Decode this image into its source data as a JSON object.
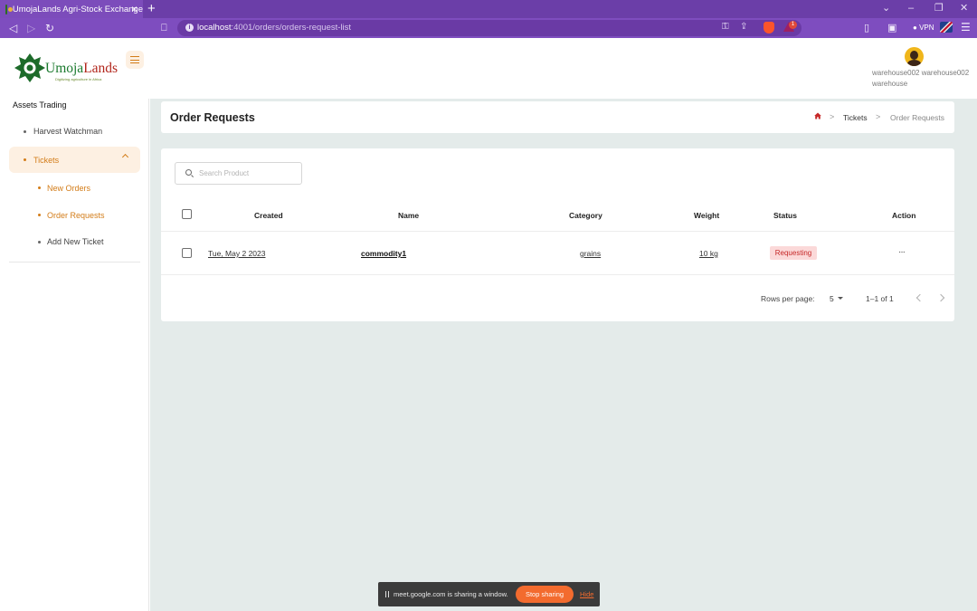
{
  "browser": {
    "tab_title": "UmojaLands Agri-Stock Exchange",
    "new_tab": "+",
    "url_host": "localhost",
    "url_rest": ":4001/orders/orders-request-list",
    "vpn": "VPN",
    "shields_badge": "1"
  },
  "header": {
    "logo_umoja": "Umoja",
    "logo_lands": "Lands",
    "logo_tagline": "Digitizing agriculture in Africa",
    "user_name": "warehouse002 warehouse002",
    "user_role": "warehouse"
  },
  "sidebar": {
    "heading": "Assets Trading",
    "items": [
      {
        "label": "Harvest Watchman"
      },
      {
        "label": "Tickets"
      }
    ],
    "subitems": [
      {
        "label": "New Orders"
      },
      {
        "label": "Order Requests"
      },
      {
        "label": "Add New Ticket"
      }
    ]
  },
  "page": {
    "title": "Order Requests",
    "breadcrumb": {
      "sep": ">",
      "tickets": "Tickets",
      "current": "Order Requests"
    }
  },
  "search": {
    "placeholder": "Search Product"
  },
  "table": {
    "columns": [
      "Created",
      "Name",
      "Category",
      "Weight",
      "Status",
      "Action"
    ],
    "rows": [
      {
        "created": "Tue, May 2 2023",
        "name": "commodity1",
        "category": "grains",
        "weight": "10 kg",
        "status": "Requesting",
        "action": "···"
      }
    ]
  },
  "pagination": {
    "rows_per_page_label": "Rows per page:",
    "rows_per_page": "5",
    "range": "1–1 of 1"
  },
  "sharebar": {
    "message": "meet.google.com is sharing a window.",
    "stop": "Stop sharing",
    "hide": "Hide"
  },
  "colors": {
    "brand_purple": "#7e4dbf",
    "accent_orange": "#d37c18",
    "status_red": "#c62828",
    "main_bg": "#e4ebea"
  }
}
